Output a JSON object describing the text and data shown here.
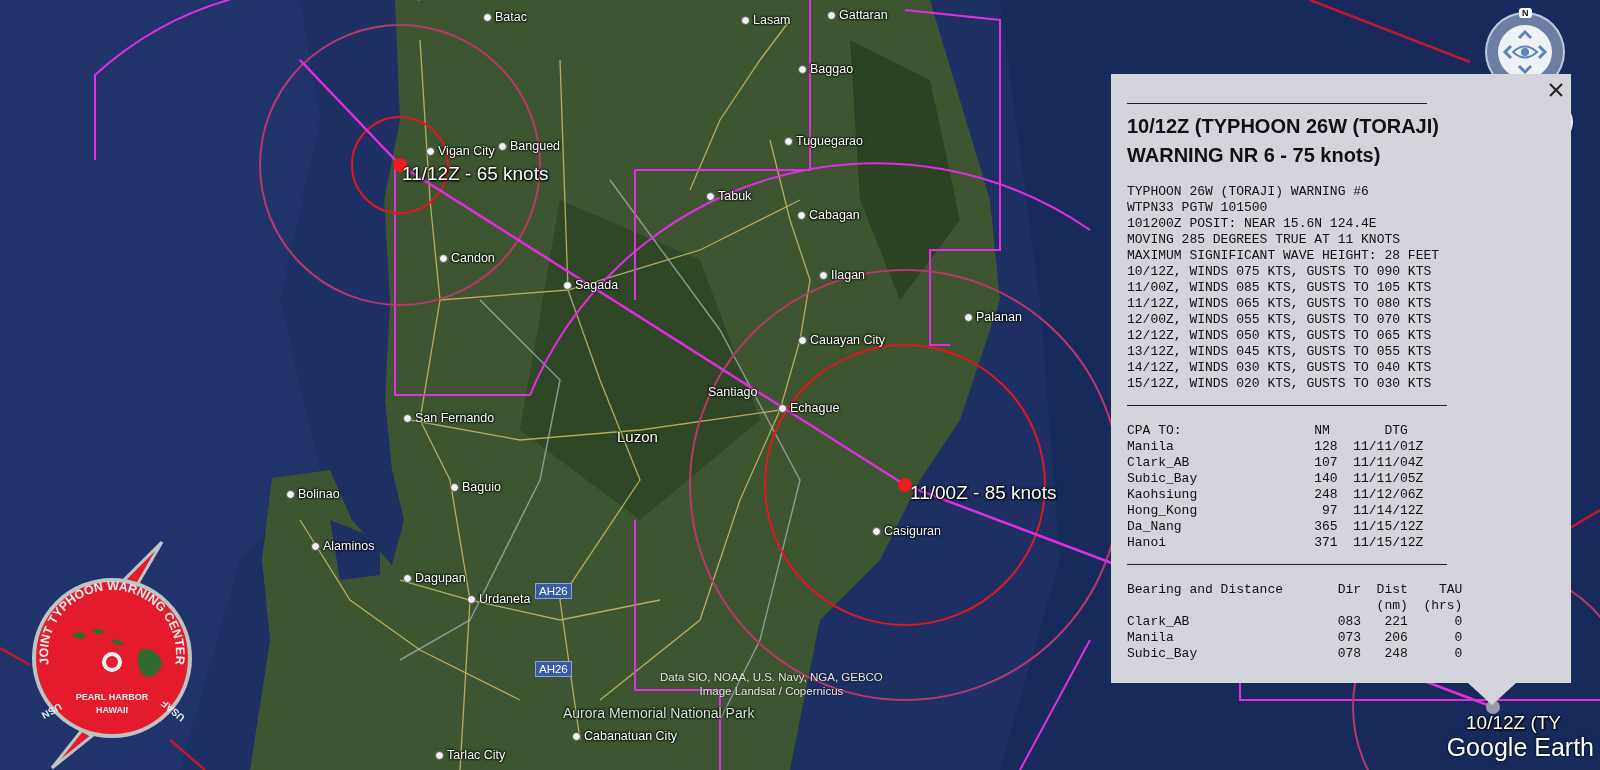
{
  "map_labels": [
    {
      "text": "Batac",
      "kind": "town"
    },
    {
      "text": "Lasam",
      "kind": "town"
    },
    {
      "text": "Gattaran",
      "kind": "town"
    },
    {
      "text": "Baggao",
      "kind": "town"
    },
    {
      "text": "Vigan City",
      "kind": "town"
    },
    {
      "text": "Bangued",
      "kind": "town"
    },
    {
      "text": "Tuguegarao",
      "kind": "town"
    },
    {
      "text": "Tabuk",
      "kind": "town"
    },
    {
      "text": "Cabagan",
      "kind": "town"
    },
    {
      "text": "Candon",
      "kind": "town"
    },
    {
      "text": "Sagada",
      "kind": "town"
    },
    {
      "text": "Ilagan",
      "kind": "town"
    },
    {
      "text": "Palanan",
      "kind": "town"
    },
    {
      "text": "Cauayan City",
      "kind": "town"
    },
    {
      "text": "Santiago",
      "kind": "area"
    },
    {
      "text": "Echague",
      "kind": "town"
    },
    {
      "text": "San Fernando",
      "kind": "town"
    },
    {
      "text": "Luzon",
      "kind": "region"
    },
    {
      "text": "Baguio",
      "kind": "town"
    },
    {
      "text": "Bolinao",
      "kind": "town"
    },
    {
      "text": "Casiguran",
      "kind": "town"
    },
    {
      "text": "Alaminos",
      "kind": "town"
    },
    {
      "text": "Dagupan",
      "kind": "town"
    },
    {
      "text": "Urdaneta",
      "kind": "town"
    },
    {
      "text": "AH26",
      "kind": "road"
    },
    {
      "text": "AH26",
      "kind": "road"
    },
    {
      "text": "Aurora Memorial National Park",
      "kind": "park"
    },
    {
      "text": "Tarlac City",
      "kind": "town"
    },
    {
      "text": "Cabanatuan City",
      "kind": "town"
    }
  ],
  "storm_labels": [
    "11/12Z - 65 knots",
    "11/00Z - 85 knots",
    "10/12Z (TY"
  ],
  "popup": {
    "title_lines": [
      "10/12Z (TYPHOON 26W (TORAJI)",
      "WARNING NR 6 - 75 knots)"
    ],
    "bulletin": [
      "TYPHOON 26W (TORAJI) WARNING #6",
      "WTPN33 PGTW 101500",
      "101200Z POSIT: NEAR 15.6N 124.4E",
      "MOVING 285 DEGREES TRUE AT 11 KNOTS",
      "MAXIMUM SIGNIFICANT WAVE HEIGHT: 28 FEET",
      "10/12Z, WINDS 075 KTS, GUSTS TO 090 KTS",
      "11/00Z, WINDS 085 KTS, GUSTS TO 105 KTS",
      "11/12Z, WINDS 065 KTS, GUSTS TO 080 KTS",
      "12/00Z, WINDS 055 KTS, GUSTS TO 070 KTS",
      "12/12Z, WINDS 050 KTS, GUSTS TO 065 KTS",
      "13/12Z, WINDS 045 KTS, GUSTS TO 055 KTS",
      "14/12Z, WINDS 030 KTS, GUSTS TO 040 KTS",
      "15/12Z, WINDS 020 KTS, GUSTS TO 030 KTS"
    ],
    "cpa": {
      "columns": [
        "CPA TO:",
        "NM",
        "DTG"
      ],
      "rows": [
        [
          "Manila",
          "128",
          "11/11/01Z"
        ],
        [
          "Clark_AB",
          "107",
          "11/11/04Z"
        ],
        [
          "Subic_Bay",
          "140",
          "11/11/05Z"
        ],
        [
          "Kaohsiung",
          "248",
          "11/12/06Z"
        ],
        [
          "Hong_Kong",
          "97",
          "11/14/12Z"
        ],
        [
          "Da_Nang",
          "365",
          "11/15/12Z"
        ],
        [
          "Hanoi",
          "371",
          "11/15/12Z"
        ]
      ]
    },
    "bearing": {
      "columns": [
        "Bearing and Distance",
        "Dir",
        "Dist",
        "TAU"
      ],
      "units": [
        "(nm)",
        "(hrs)"
      ],
      "rows": [
        [
          "Clark_AB",
          "083",
          "221",
          "0"
        ],
        [
          "Manila",
          "073",
          "206",
          "0"
        ],
        [
          "Subic_Bay",
          "078",
          "248",
          "0"
        ]
      ]
    }
  },
  "logo": {
    "arc_text": "JOINT TYPHOON WARNING CENTER",
    "lines": [
      "PEARL HARBOR",
      "HAWAII"
    ],
    "left_mark": "USN",
    "right_mark": "USAF"
  },
  "compass": {
    "north": "N"
  },
  "attribution": [
    "Data SIO, NOAA, U.S. Navy, NGA, GEBCO",
    "Image Landsat / Copernicus"
  ],
  "brand": "Google Earth"
}
